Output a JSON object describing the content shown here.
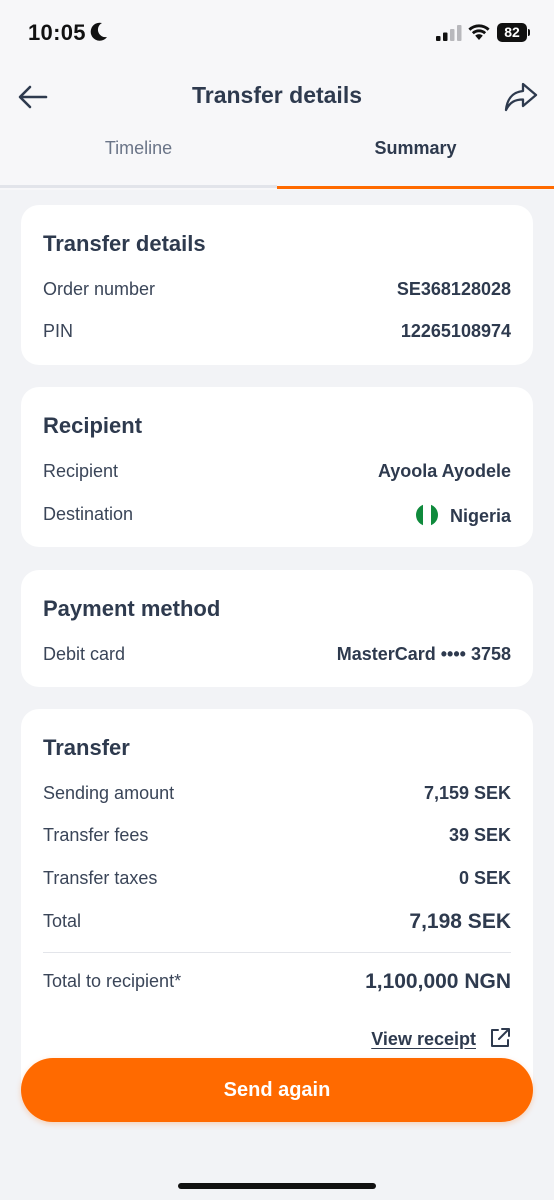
{
  "status_bar": {
    "time": "10:05",
    "battery": "82"
  },
  "nav": {
    "title": "Transfer details"
  },
  "tabs": [
    {
      "label": "Timeline",
      "active": false
    },
    {
      "label": "Summary",
      "active": true
    }
  ],
  "transfer_details": {
    "title": "Transfer details",
    "rows": [
      {
        "label": "Order number",
        "value": "SE368128028"
      },
      {
        "label": "PIN",
        "value": "12265108974"
      }
    ]
  },
  "recipient": {
    "title": "Recipient",
    "rows": [
      {
        "label": "Recipient",
        "value": "Ayoola Ayodele"
      },
      {
        "label": "Destination",
        "value": "Nigeria",
        "icon": "nigeria-flag-icon"
      }
    ]
  },
  "payment_method": {
    "title": "Payment method",
    "rows": [
      {
        "label": "Debit card",
        "value": "MasterCard •••• 3758"
      }
    ]
  },
  "transfer": {
    "title": "Transfer",
    "rows": [
      {
        "label": "Sending amount",
        "value": "7,159 SEK"
      },
      {
        "label": "Transfer fees",
        "value": "39 SEK"
      },
      {
        "label": "Transfer taxes",
        "value": "0 SEK"
      },
      {
        "label": "Total",
        "value": "7,198 SEK"
      },
      {
        "label": "Total to recipient*",
        "value": "1,100,000 NGN"
      }
    ],
    "view_receipt_label": "View receipt"
  },
  "send_again_label": "Send again",
  "colors": {
    "accent": "#ff6a00",
    "text": "#2e3a4e",
    "background": "#f2f3f6"
  },
  "icons": [
    "back-arrow-icon",
    "share-icon",
    "external-link-icon",
    "moon-icon",
    "signal-icon",
    "wifi-icon",
    "battery-icon"
  ]
}
